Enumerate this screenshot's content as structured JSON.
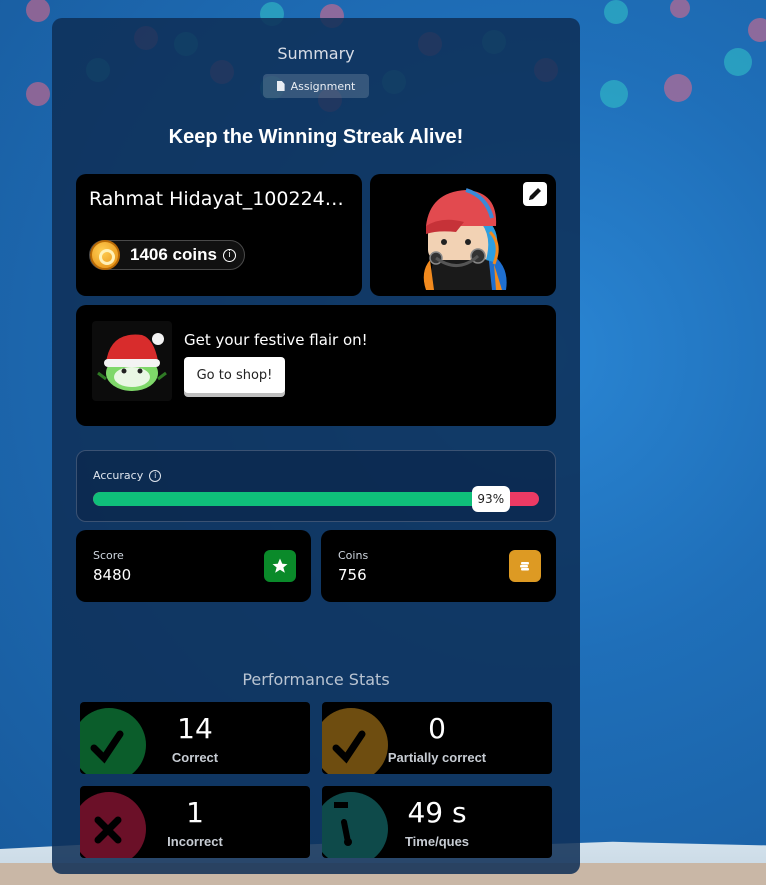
{
  "summary": {
    "title": "Summary",
    "assignment_label": "Assignment",
    "headline": "Keep the Winning Streak Alive!"
  },
  "player": {
    "name": "Rahmat Hidayat_1002240...",
    "coins_label": "1406 coins"
  },
  "shop": {
    "text": "Get your festive flair on!",
    "button_label": "Go to shop!"
  },
  "accuracy": {
    "label": "Accuracy",
    "percent": 93,
    "percent_label": "93%"
  },
  "stats": {
    "score_label": "Score",
    "score_value": "8480",
    "coins_label": "Coins",
    "coins_value": "756"
  },
  "performance": {
    "title": "Performance Stats",
    "items": [
      {
        "value": "14",
        "label": "Correct",
        "icon": "check-icon",
        "color": "#0b5d2b"
      },
      {
        "value": "0",
        "label": "Partially correct",
        "icon": "check-icon",
        "color": "#6e4d10"
      },
      {
        "value": "1",
        "label": "Incorrect",
        "icon": "cross-icon",
        "color": "#6b1028"
      },
      {
        "value": "49 s",
        "label": "Time/ques",
        "icon": "stopwatch-icon",
        "color": "#0e4a4a"
      }
    ]
  },
  "colors": {
    "accuracy_fill": "#0fbf7a",
    "accuracy_remainder": "#ec3a64",
    "score_icon_bg": "#0a8a2a",
    "coins_icon_bg": "#dd9a23"
  }
}
